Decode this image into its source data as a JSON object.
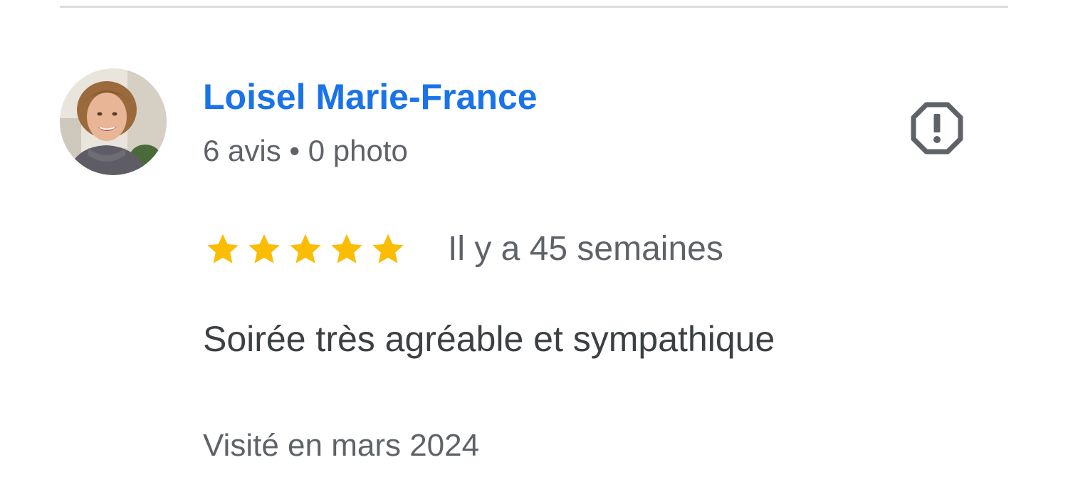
{
  "review": {
    "author": {
      "name": "Loisel Marie-France",
      "meta": "6 avis • 0 photo",
      "avatar_icon": "profile-photo"
    },
    "rating": {
      "stars": 5,
      "max": 5,
      "color": "#fbbc04"
    },
    "age": "Il y a 45 semaines",
    "text": "Soirée très agréable et sympathique",
    "visit": "Visité en mars 2024",
    "report_icon": "report-octagon-icon"
  },
  "colors": {
    "name": "#1a73e8",
    "secondary_text": "#5f6368",
    "body_text": "#3c4043",
    "icon": "#5f6368",
    "divider": "#dadce0"
  }
}
